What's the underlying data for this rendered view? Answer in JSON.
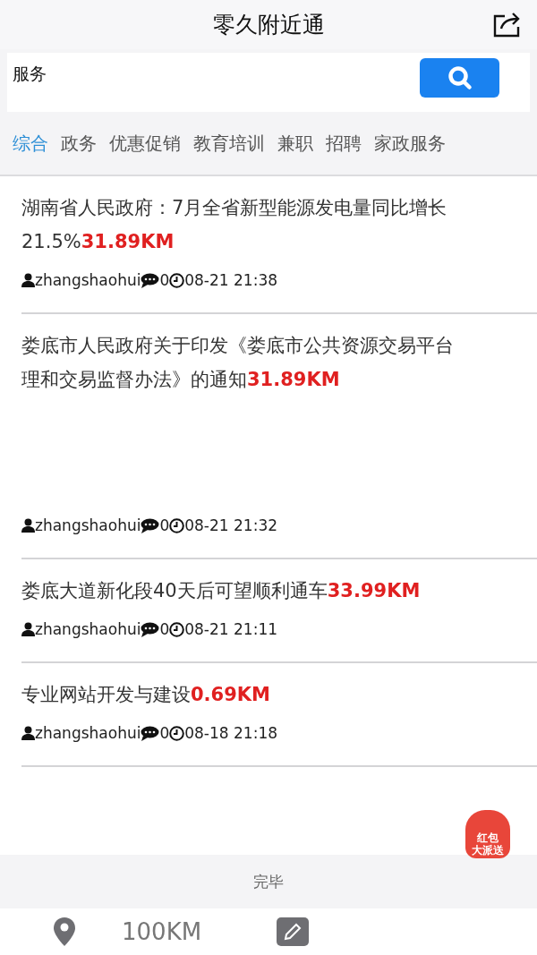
{
  "header": {
    "title": "零久附近通"
  },
  "search": {
    "value": "服务"
  },
  "tabs": [
    {
      "label": "综合",
      "selected": true
    },
    {
      "label": "政务",
      "selected": false
    },
    {
      "label": "优惠促销",
      "selected": false
    },
    {
      "label": "教育培训",
      "selected": false
    },
    {
      "label": "兼职",
      "selected": false
    },
    {
      "label": "招聘",
      "selected": false
    },
    {
      "label": "家政服务",
      "selected": false
    }
  ],
  "posts": [
    {
      "title_lines": [
        "湖南省人民政府：7月全省新型能源发电量同比增长",
        "21.5%"
      ],
      "distance": "31.89KM",
      "author": "zhangshaohui",
      "comments": "0",
      "time": "08-21 21:38",
      "tall": false
    },
    {
      "title_lines": [
        "娄底市人民政府关于印发《娄底市公共资源交易平台",
        "理和交易监督办法》的通知"
      ],
      "distance": "31.89KM",
      "author": "zhangshaohui",
      "comments": "0",
      "time": "08-21 21:32",
      "tall": true
    },
    {
      "title_lines": [
        "娄底大道新化段40天后可望顺利通车"
      ],
      "distance": "33.99KM",
      "author": "zhangshaohui",
      "comments": "0",
      "time": "08-21 21:11",
      "tall": false
    },
    {
      "title_lines": [
        "专业网站开发与建设"
      ],
      "distance": "0.69KM",
      "author": "zhangshaohui",
      "comments": "0",
      "time": "08-18 21:18",
      "tall": false
    }
  ],
  "promo": {
    "line1": "红包",
    "line2": "大派送"
  },
  "footer": {
    "status": "完毕"
  },
  "bottom_bar": {
    "range": "100KM"
  }
}
